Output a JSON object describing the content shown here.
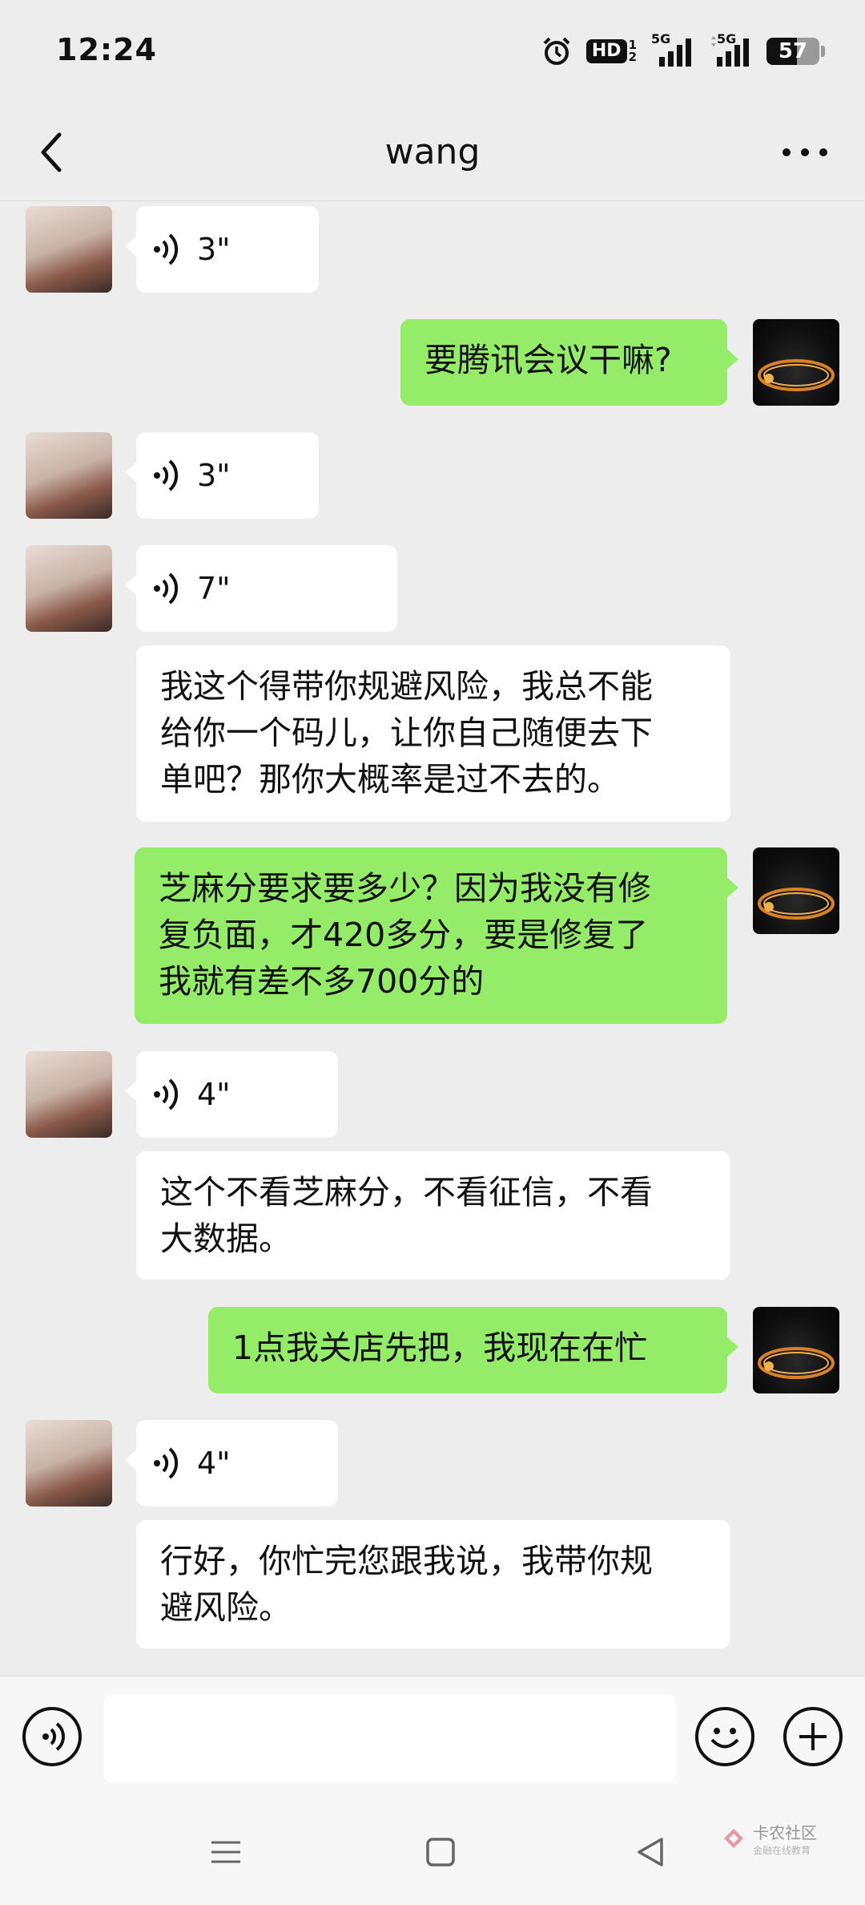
{
  "status_bar": {
    "time": "12:24",
    "hd_label": "HD",
    "hd_sub": [
      "1",
      "2"
    ],
    "net_label": "5G",
    "battery_level": "57",
    "battery_fraction": 0.57
  },
  "header": {
    "title": "wang"
  },
  "messages": [
    {
      "from": "other",
      "type": "voice",
      "duration": "3\""
    },
    {
      "from": "self",
      "type": "text",
      "text": "要腾讯会议干嘛?"
    },
    {
      "from": "other",
      "type": "voice",
      "duration": "3\""
    },
    {
      "from": "other",
      "type": "voice",
      "duration": "7\""
    },
    {
      "from": "other",
      "type": "text",
      "lines": [
        "我这个得带你规避风险，我总不能",
        "给你一个码儿，让你自己随便去下",
        "单吧？那你大概率是过不去的。"
      ]
    },
    {
      "from": "self",
      "type": "text",
      "lines": [
        "芝麻分要求要多少？因为我没有修",
        "复负面，才420多分，要是修复了",
        "我就有差不多700分的"
      ]
    },
    {
      "from": "other",
      "type": "voice",
      "duration": "4\""
    },
    {
      "from": "other",
      "type": "text",
      "lines": [
        "这个不看芝麻分，不看征信，不看",
        "大数据。"
      ]
    },
    {
      "from": "self",
      "type": "text",
      "text": "1点我关店先把，我现在在忙"
    },
    {
      "from": "other",
      "type": "voice",
      "duration": "4\""
    },
    {
      "from": "other",
      "type": "text",
      "lines": [
        "行好，你忙完您跟我说，我带你规",
        "避风险。"
      ]
    }
  ],
  "input_bar": {
    "placeholder": "",
    "icons": [
      "voice-icon",
      "emoji-icon",
      "plus-icon"
    ]
  },
  "watermark": {
    "text": "卡农社区",
    "sub": "金融在线教育"
  },
  "colors": {
    "background": "#ededed",
    "outgoing_bubble": "#95ec69",
    "incoming_bubble": "#ffffff"
  }
}
